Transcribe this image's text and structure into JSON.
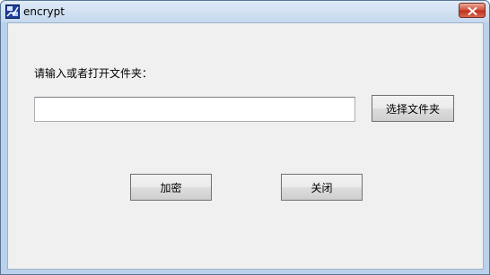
{
  "window": {
    "title": "encrypt",
    "app_icon": "program-icon",
    "close_icon": "close-icon"
  },
  "form": {
    "prompt_label": "请输入或者打开文件夹：",
    "path_value": "",
    "select_folder_label": "选择文件夹",
    "encrypt_label": "加密",
    "close_label": "关闭"
  },
  "colors": {
    "client_background": "#f0f0f0",
    "titlebar": "#c5d8ee",
    "close_button": "#c9432e"
  }
}
